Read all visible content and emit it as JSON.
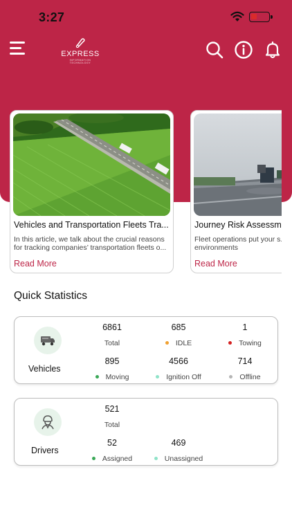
{
  "status": {
    "time": "3:27"
  },
  "header": {
    "logo": {
      "text": "EXPRESS",
      "subtext": "INFORMATION TECHNOLOGY"
    },
    "icons": [
      "menu-icon",
      "search-icon",
      "info-icon",
      "bell-icon"
    ]
  },
  "articles": [
    {
      "title": "Vehicles and Transportation Fleets Tra...",
      "description": "In this article, we talk about the crucial reasons for tracking companies’ transportation fleets o...",
      "link": "Read More"
    },
    {
      "title": "Journey Risk Assessme...",
      "description": "Fleet operations put your s... the dynamic environments",
      "link": "Read More"
    }
  ],
  "quick_stats": {
    "title": "Quick Statistics",
    "vehicles": {
      "label": "Vehicles",
      "metrics": [
        {
          "value": "6861",
          "label": "Total",
          "dot": ""
        },
        {
          "value": "685",
          "label": "IDLE",
          "dot": "#f0a030"
        },
        {
          "value": "1",
          "label": "Towing",
          "dot": "#d42020"
        },
        {
          "value": "895",
          "label": "Moving",
          "dot": "#3aa857"
        },
        {
          "value": "4566",
          "label": "Ignition Off",
          "dot": "#8fe3c8"
        },
        {
          "value": "714",
          "label": "Offline",
          "dot": "#b5b5b5"
        }
      ]
    },
    "drivers": {
      "label": "Drivers",
      "metrics": [
        {
          "value": "521",
          "label": "Total",
          "dot": ""
        },
        {
          "value": "52",
          "label": "Assigned",
          "dot": "#3aa857"
        },
        {
          "value": "469",
          "label": "Unassigned",
          "dot": "#8fe3c8"
        }
      ]
    }
  },
  "colors": {
    "brand": "#bd2547",
    "avatar_bg": "#e7f3ea"
  }
}
